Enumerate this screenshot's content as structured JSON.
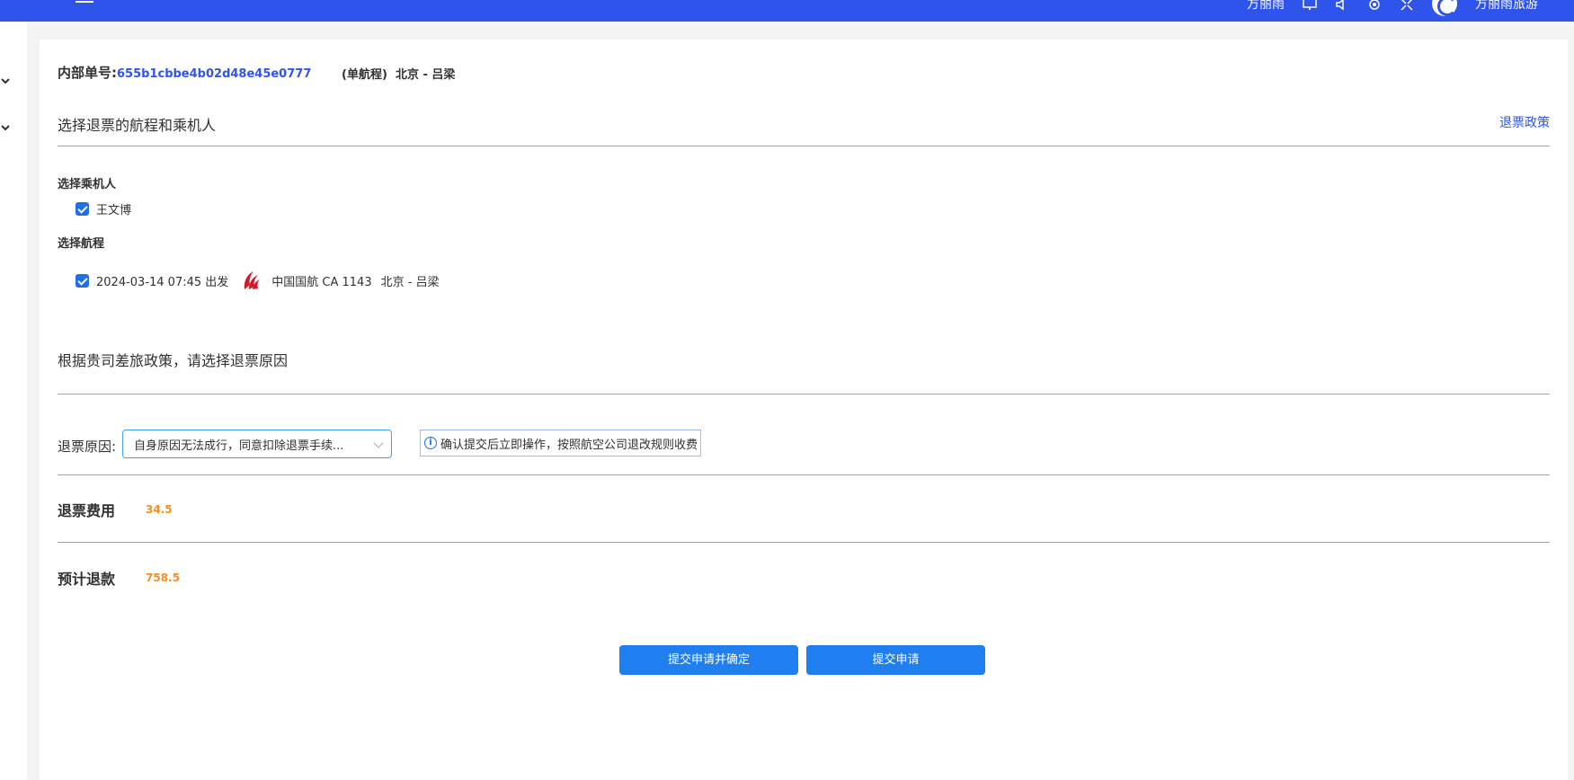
{
  "header": {
    "user_name": "方丽雨",
    "account_name": "方丽雨旅游",
    "bg_color": "#2f54eb"
  },
  "order": {
    "label": "内部单号:",
    "number": "655b1cbbe4b02d48e45e0777",
    "trip_type": "(单航程)",
    "route": "北京 - 吕梁"
  },
  "section_select": {
    "title": "选择退票的航程和乘机人",
    "policy_link": "退票政策"
  },
  "passengers": {
    "title": "选择乘机人",
    "items": [
      {
        "name": "王文博",
        "checked": true
      }
    ]
  },
  "segments": {
    "title": "选择航程",
    "items": [
      {
        "checked": true,
        "datetime": "2024-03-14 07:45 出发",
        "airline": "中国国航 CA 1143",
        "route": "北京 - 吕梁",
        "logo_icon": "air-china-logo-icon"
      }
    ]
  },
  "reason_section": {
    "title": "根据贵司差旅政策，请选择退票原因",
    "label": "退票原因:",
    "selected": "自身原因无法成行，同意扣除退票手续...",
    "notice": "确认提交后立即操作，按照航空公司退改规则收费"
  },
  "fees": {
    "refund_fee_label": "退票费用",
    "refund_fee_value": "34.5",
    "estimate_label": "预计退款",
    "estimate_value": "758.5",
    "value_color": "#ff8c1a"
  },
  "actions": {
    "submit_confirm": "提交申请并确定",
    "submit": "提交申请",
    "button_color": "#1f7ff0"
  }
}
